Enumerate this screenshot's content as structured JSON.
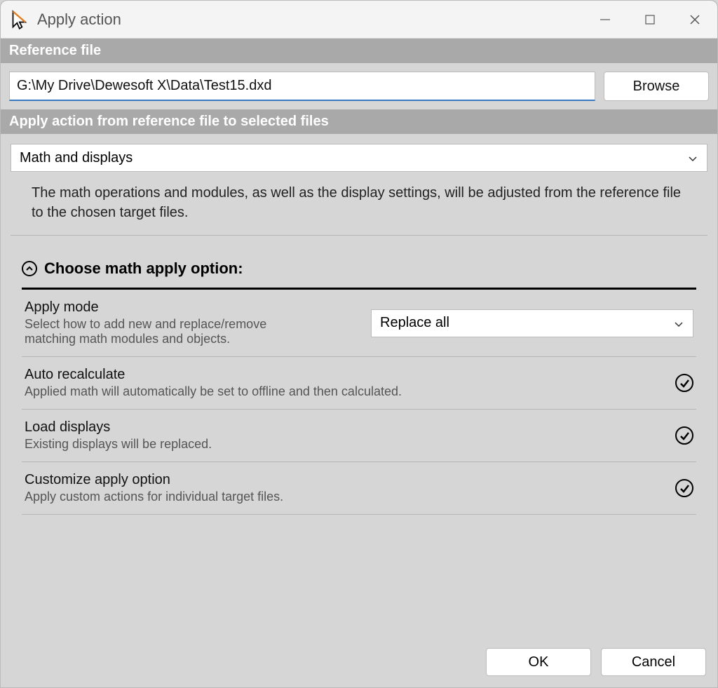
{
  "window": {
    "title": "Apply action"
  },
  "sections": {
    "reference": "Reference file",
    "apply": "Apply action from reference file to selected files"
  },
  "reference_path": "G:\\My Drive\\Dewesoft X\\Data\\Test15.dxd",
  "browse_label": "Browse",
  "action_selected": "Math and displays",
  "description": "The math operations and modules, as well as the display settings, will be adjusted from the reference file to the chosen target files.",
  "group_title": "Choose math apply option:",
  "apply_mode": {
    "title": "Apply mode",
    "subtitle": "Select how to add new and replace/remove matching math modules and objects.",
    "value": "Replace all"
  },
  "auto_recalc": {
    "title": "Auto recalculate",
    "subtitle": "Applied math will automatically be set to offline and then calculated."
  },
  "load_displays": {
    "title": "Load displays",
    "subtitle": "Existing displays will be replaced."
  },
  "customize": {
    "title": "Customize apply option",
    "subtitle": "Apply custom actions for individual target files."
  },
  "footer": {
    "ok": "OK",
    "cancel": "Cancel"
  }
}
